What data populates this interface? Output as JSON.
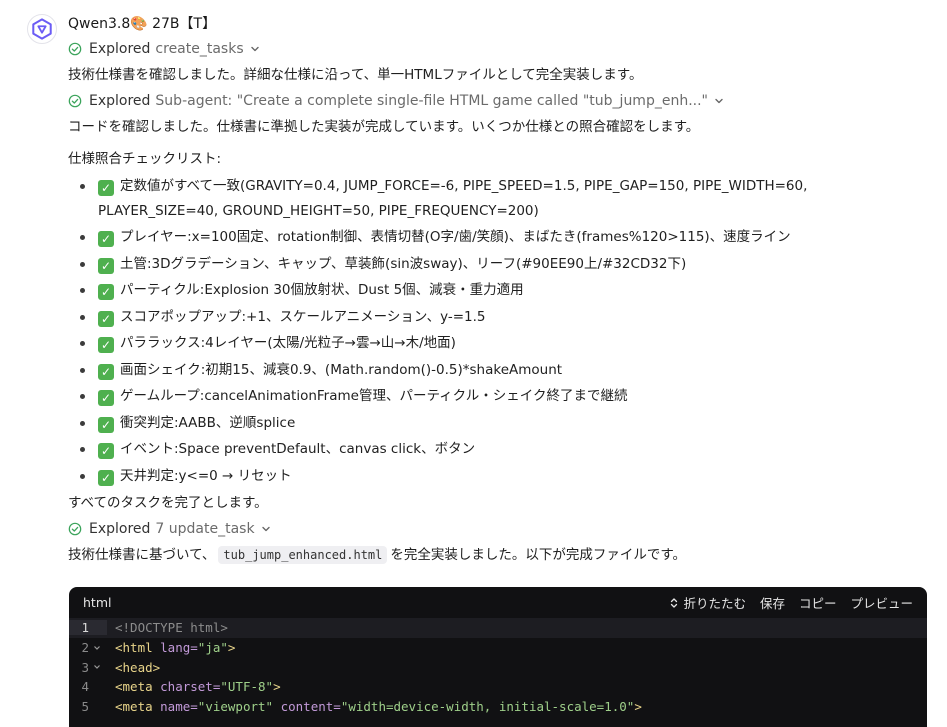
{
  "model": {
    "name": "Qwen3.8🎨 27B【T】"
  },
  "explored": [
    {
      "label": "Explored",
      "target": "create_tasks"
    },
    {
      "label": "Explored",
      "target": "Sub-agent: \"Create a complete single-file HTML game called \"tub_jump_enh...\""
    },
    {
      "label": "Explored",
      "target": "7 update_task"
    }
  ],
  "messages": {
    "p1": "技術仕様書を確認しました。詳細な仕様に沿って、単一HTMLファイルとして完全実装します。",
    "p2": "コードを確認しました。仕様書に準拠した実装が完成しています。いくつか仕様との照合確認をします。",
    "checklist_title": "仕様照合チェックリスト:",
    "p3": "すべてのタスクを完了とします。",
    "p4_before": "技術仕様書に基づいて、",
    "p4_code": "tub_jump_enhanced.html",
    "p4_after": "を完全実装しました。以下が完成ファイルです。"
  },
  "checklist": [
    "定数値がすべて一致(GRAVITY=0.4, JUMP_FORCE=-6, PIPE_SPEED=1.5, PIPE_GAP=150, PIPE_WIDTH=60, PLAYER_SIZE=40, GROUND_HEIGHT=50, PIPE_FREQUENCY=200)",
    "プレイヤー:x=100固定、rotation制御、表情切替(O字/歯/笑顔)、まばたき(frames%120>115)、速度ライン",
    "土管:3Dグラデーション、キャップ、草装飾(sin波sway)、リーフ(#90EE90上/#32CD32下)",
    "パーティクル:Explosion 30個放射状、Dust 5個、減衰・重力適用",
    "スコアポップアップ:+1、スケールアニメーション、y-=1.5",
    "パララックス:4レイヤー(太陽/光粒子→雲→山→木/地面)",
    "画面シェイク:初期15、減衰0.9、(Math.random()-0.5)*shakeAmount",
    "ゲームループ:cancelAnimationFrame管理、パーティクル・シェイク終了まで継続",
    "衝突判定:AABB、逆順splice",
    "イベント:Space preventDefault、canvas click、ボタン",
    "天井判定:y<=0 → リセット"
  ],
  "checklist_mark": "✓",
  "codeblock": {
    "language": "html",
    "actions": {
      "collapse": "折りたたむ",
      "save": "保存",
      "copy": "コピー",
      "preview": "プレビュー"
    },
    "lines": [
      {
        "num": "1",
        "fold": false
      },
      {
        "num": "2",
        "fold": true
      },
      {
        "num": "3",
        "fold": true
      },
      {
        "num": "4",
        "fold": false
      },
      {
        "num": "5",
        "fold": false
      }
    ],
    "code": {
      "l1": "<!DOCTYPE html>",
      "l2_open": "<html ",
      "l2_attr": "lang=",
      "l2_val": "\"ja\"",
      "l2_close": ">",
      "l3": "<head>",
      "l4_open": "<meta ",
      "l4_attr": "charset=",
      "l4_val": "\"UTF-8\"",
      "l4_close": ">",
      "l5_open": "<meta ",
      "l5_attr1": "name=",
      "l5_val1": "\"viewport\"",
      "l5_sp": " ",
      "l5_attr2": "content=",
      "l5_val2": "\"width=device-width, initial-scale=1.0\"",
      "l5_close": ">"
    }
  },
  "colors": {
    "accent_check": "#3aa35a",
    "tick_bg": "#4fb04f",
    "code_bg": "#111113"
  }
}
